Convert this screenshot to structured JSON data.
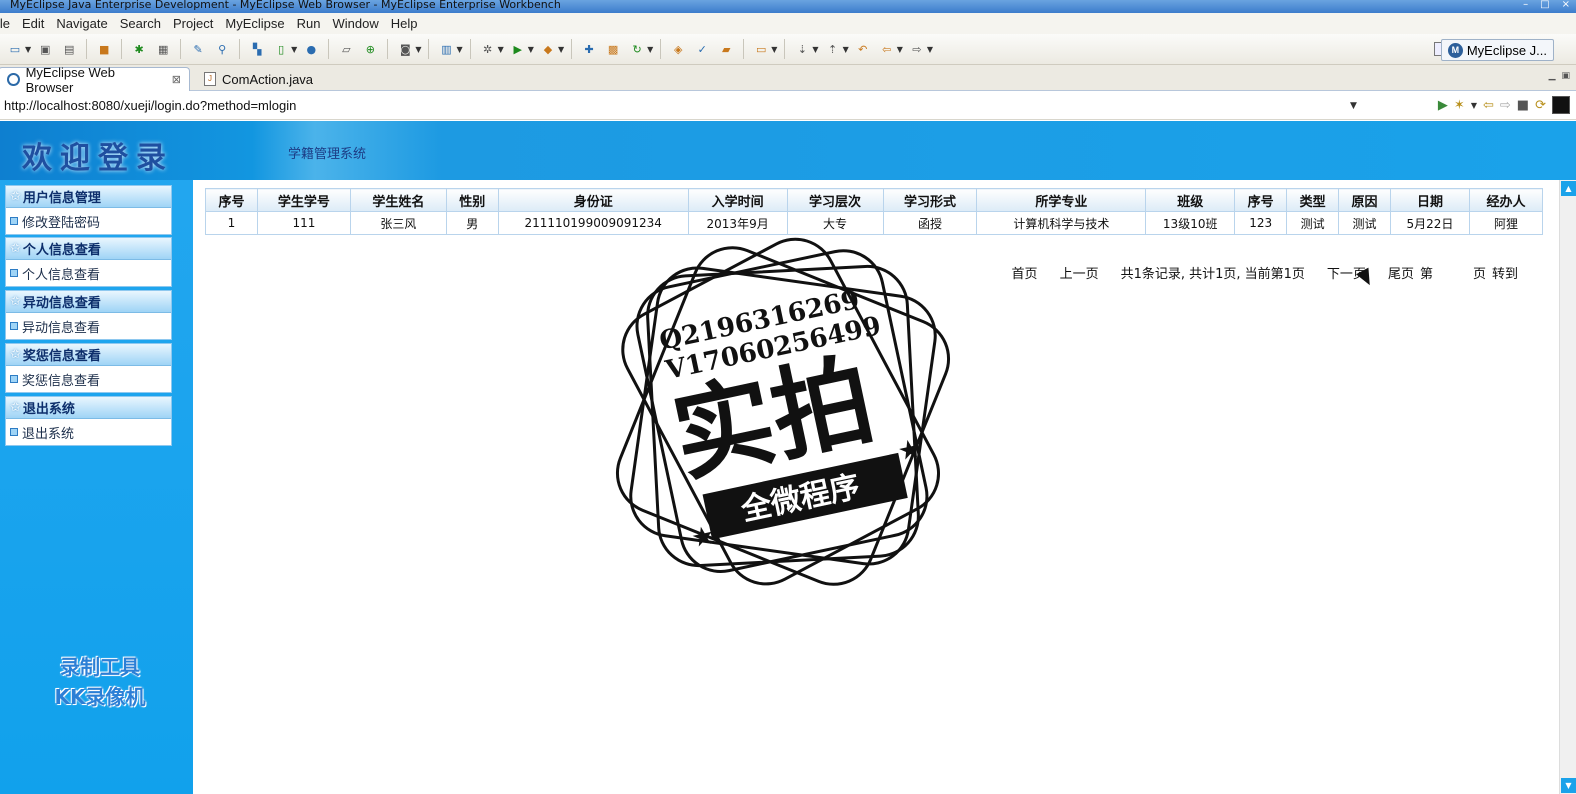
{
  "window": {
    "title": "MyEclipse Java Enterprise Development - MyEclipse Web Browser - MyEclipse Enterprise Workbench",
    "controls": [
      "–",
      "□",
      "×"
    ]
  },
  "menu": [
    "ile",
    "Edit",
    "Navigate",
    "Search",
    "Project",
    "MyEclipse",
    "Run",
    "Window",
    "Help"
  ],
  "toolbar": {
    "perspective_label": "MyEclipse J..."
  },
  "tabs": [
    {
      "label": "MyEclipse Web Browser",
      "close": "⊠"
    },
    {
      "label": "ComAction.java"
    }
  ],
  "browser": {
    "url": "http://localhost:8080/xueji/login.do?method=mlogin"
  },
  "banner": {
    "welcome": "欢迎登录",
    "system": "学籍管理系统"
  },
  "sidebar": {
    "groups": [
      {
        "title": "用户信息管理",
        "item": "修改登陆密码"
      },
      {
        "title": "个人信息查看",
        "item": "个人信息查看"
      },
      {
        "title": "异动信息查看",
        "item": "异动信息查看"
      },
      {
        "title": "奖惩信息查看",
        "item": "奖惩信息查看"
      },
      {
        "title": "退出系统",
        "item": "退出系统"
      }
    ]
  },
  "table": {
    "headers": [
      "序号",
      "学生学号",
      "学生姓名",
      "性别",
      "身份证",
      "入学时间",
      "学习层次",
      "学习形式",
      "所学专业",
      "班级",
      "序号",
      "类型",
      "原因",
      "日期",
      "经办人"
    ],
    "rows": [
      [
        "1",
        "111",
        "张三风",
        "男",
        "211110199009091234",
        "2013年9月",
        "大专",
        "函授",
        "计算机科学与技术",
        "13级10班",
        "123",
        "测试",
        "测试",
        "5月22日",
        "阿狸"
      ]
    ]
  },
  "pager": {
    "first": "首页",
    "prev": "上一页",
    "summary": "共1条记录, 共计1页, 当前第1页",
    "next": "下一页",
    "last": "尾页",
    "page_prefix": "第",
    "page_suffix": "页",
    "goto": "转到"
  },
  "watermark": {
    "qq": "Q2196316269",
    "wechat": "V17060256499",
    "big": "实拍",
    "ribbon": "全微程序"
  },
  "recorder": {
    "line1": "录制工具",
    "line2": "KK录像机"
  }
}
